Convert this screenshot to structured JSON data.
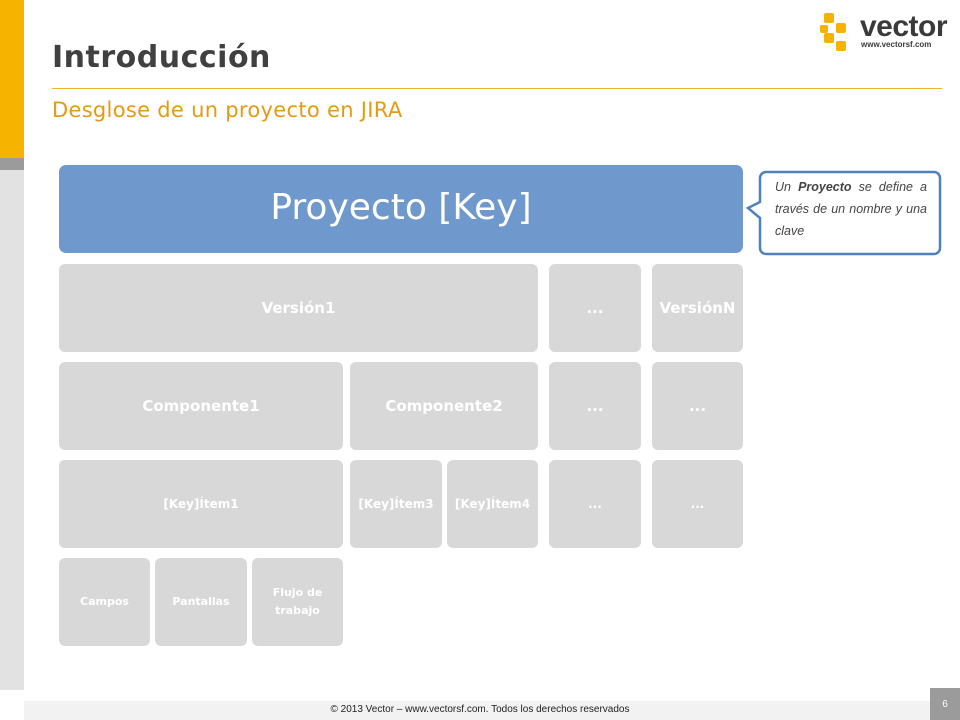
{
  "header": {
    "title": "Introducción",
    "subtitle": "Desglose de un proyecto en JIRA"
  },
  "logo": {
    "name": "vector",
    "url": "www.vectorsf.com"
  },
  "diagram": {
    "project": "Proyecto [Key]",
    "versions": [
      "Versión1",
      "...",
      "VersiónN"
    ],
    "components": [
      "Componente1",
      "Componente2",
      "...",
      "..."
    ],
    "items": [
      "[Key]Ítem1",
      "[Key]Ítem3",
      "[Key]Ítem4",
      "...",
      "..."
    ],
    "item_parts": [
      "Campos",
      "Pantallas",
      "Flujo de trabajo"
    ]
  },
  "callout": {
    "before": "Un ",
    "bold": "Proyecto",
    "after": " se define a través de un nombre y una clave"
  },
  "footer": {
    "copyright": "© 2013 Vector – www.vectorsf.com. Todos los derechos reservados",
    "page": "6"
  },
  "colors": {
    "accent": "#f6b400",
    "project_box": "#6f99cd",
    "grey_box": "#d8d8d8",
    "subtitle": "#e59a14"
  }
}
